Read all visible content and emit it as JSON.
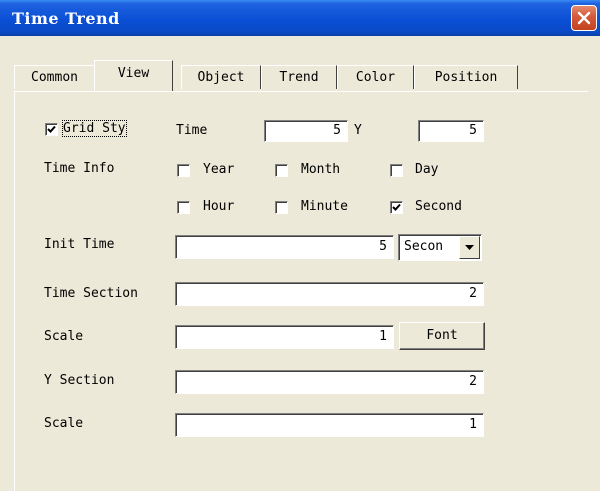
{
  "window": {
    "title": "Time Trend",
    "close_icon": "close-icon"
  },
  "tabs": [
    {
      "label": "Common"
    },
    {
      "label": "View",
      "active": true
    },
    {
      "label": "Object"
    },
    {
      "label": "Trend"
    },
    {
      "label": "Color"
    },
    {
      "label": "Position"
    }
  ],
  "grid": {
    "style_label": "Grid Sty",
    "style_checked": true,
    "time_label": "Time",
    "time_value": "5",
    "y_label": "Y",
    "y_value": "5"
  },
  "time_info": {
    "label": "Time Info",
    "options": [
      {
        "label": "Year",
        "checked": false
      },
      {
        "label": "Month",
        "checked": false
      },
      {
        "label": "Day",
        "checked": false
      },
      {
        "label": "Hour",
        "checked": false
      },
      {
        "label": "Minute",
        "checked": false
      },
      {
        "label": "Second",
        "checked": true
      }
    ]
  },
  "init_time": {
    "label": "Init Time",
    "value": "5",
    "unit": "Secon"
  },
  "time_section": {
    "label": "Time Section",
    "value": "2"
  },
  "time_scale": {
    "label": "Scale",
    "value": "1",
    "font_button": "Font"
  },
  "y_section": {
    "label": "Y Section",
    "value": "2"
  },
  "y_scale": {
    "label": "Scale",
    "value": "1"
  }
}
